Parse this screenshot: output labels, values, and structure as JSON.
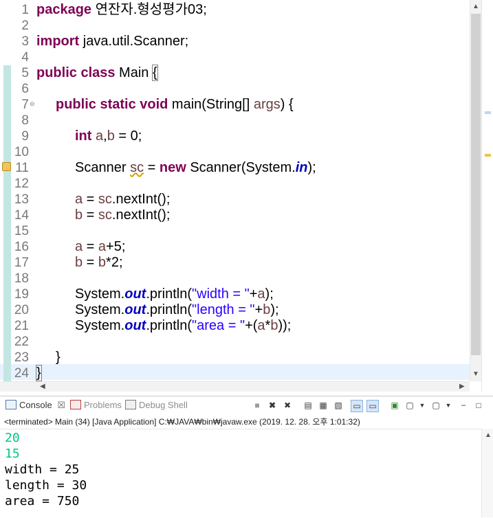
{
  "editor": {
    "line_numbers": [
      "1",
      "2",
      "3",
      "4",
      "5",
      "6",
      "7",
      "8",
      "9",
      "10",
      "11",
      "12",
      "13",
      "14",
      "15",
      "16",
      "17",
      "18",
      "19",
      "20",
      "21",
      "22",
      "23",
      "24"
    ],
    "code": {
      "l1_kw": "package",
      "l1_pkg": " 연잔자.형성평가03;",
      "l3_kw": "import",
      "l3_rest": " java.util.Scanner;",
      "l5_kw": "public class",
      "l5_name": " Main ",
      "l5_brace": "{",
      "l7_kw": "public static void",
      "l7_rest": " main(String[] ",
      "l7_args": "args",
      "l7_end": ") {",
      "l9_kw": "int",
      "l9_a": " a",
      "l9_comma": ",",
      "l9_b": "b",
      "l9_end": " = 0;",
      "l11_type": "Scanner ",
      "l11_sc": "sc",
      "l11_eq": " = ",
      "l11_new": "new",
      "l11_ctor": " Scanner(System.",
      "l11_in": "in",
      "l11_end": ");",
      "l13_a": "a",
      "l13_eq": " = ",
      "l13_sc": "sc",
      "l13_call": ".nextInt();",
      "l14_b": "b",
      "l14_eq": " = ",
      "l14_sc": "sc",
      "l14_call": ".nextInt();",
      "l16_a": "a",
      "l16_eq": " = ",
      "l16_a2": "a",
      "l16_end": "+5;",
      "l17_b": "b",
      "l17_eq": " = ",
      "l17_b2": "b",
      "l17_end": "*2;",
      "sys": "System.",
      "out": "out",
      "println": ".println(",
      "l19_str": "\"width = \"",
      "l19_plus": "+",
      "l19_a": "a",
      "l19_end": ");",
      "l20_str": "\"length = \"",
      "l20_plus": "+",
      "l20_b": "b",
      "l20_end": ");",
      "l21_str": "\"area = \"",
      "l21_plus": "+(",
      "l21_a": "a",
      "l21_mul": "*",
      "l21_b": "b",
      "l21_end": "));",
      "l23": "}",
      "l24": "}"
    }
  },
  "console": {
    "tabs": {
      "console": "Console",
      "console_close": "☒",
      "problems": "Problems",
      "debug_shell": "Debug Shell"
    },
    "terminated_label": "<terminated> Main (34) [Java Application] C:₩JAVA₩bin₩javaw.exe (2019. 12. 28. 오후 1:01:32)",
    "input_lines": [
      "20",
      "15"
    ],
    "output_lines": [
      "width = 25",
      "length = 30",
      "area = 750"
    ],
    "colors": {
      "input": "#00c87d",
      "output": "#000000"
    }
  },
  "colors": {
    "keyword": "#7f0055",
    "string": "#2a00ff",
    "field": "#0000c0",
    "local_variable": "#6a3e3e",
    "current_line": "#e8f2fe",
    "change_bar": "#c3e6e3"
  },
  "icons": {
    "fold": "fold-minus-icon",
    "warning": "warning-lightbulb-icon",
    "console": "console-icon",
    "problems": "problems-icon",
    "debug_shell": "debug-shell-icon",
    "scroll_up": "▲",
    "scroll_down": "▼",
    "scroll_left": "◀",
    "scroll_right": "▶"
  }
}
